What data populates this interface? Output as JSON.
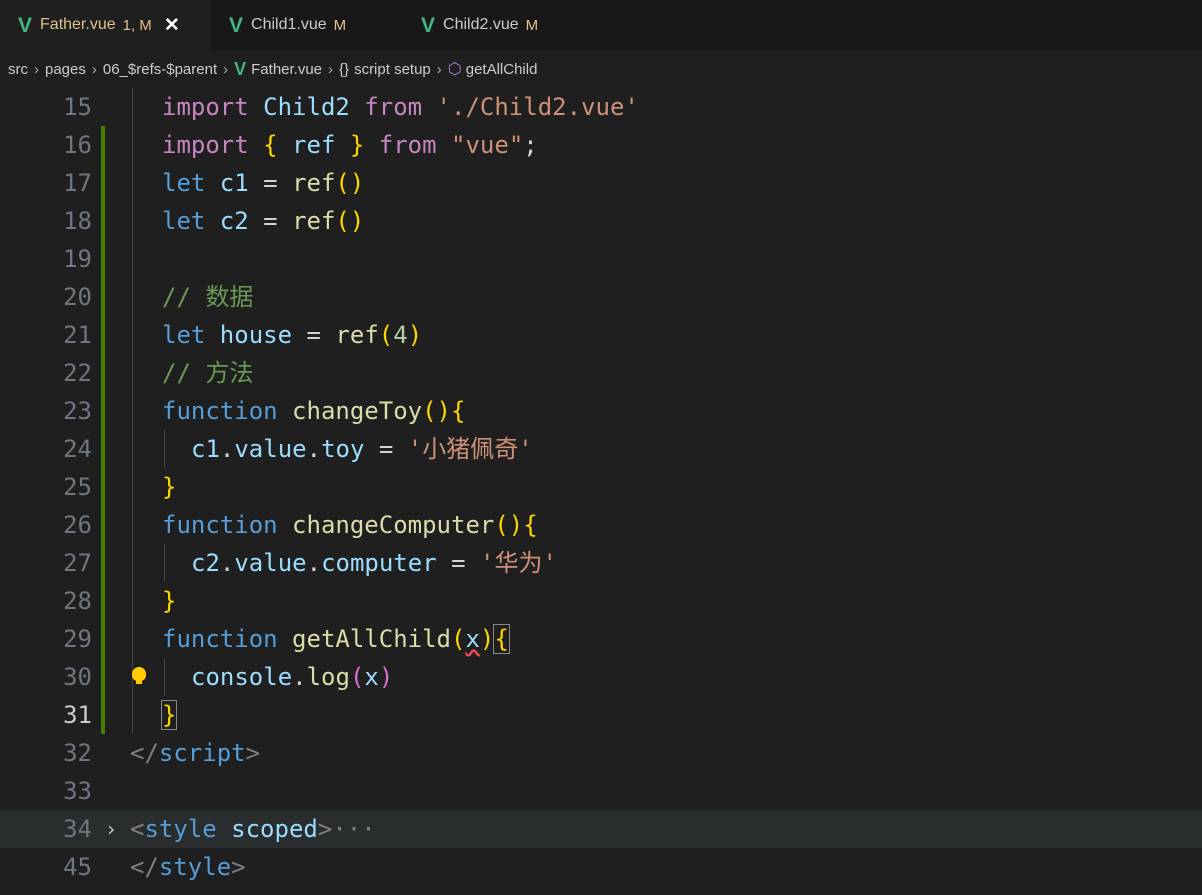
{
  "tabs": [
    {
      "name": "Father.vue",
      "status": "1, M",
      "icon": "vue-icon",
      "active": true
    },
    {
      "name": "Child1.vue",
      "status": "M",
      "icon": "vue-icon",
      "active": false
    },
    {
      "name": "Child2.vue",
      "status": "M",
      "icon": "vue-icon",
      "active": false
    }
  ],
  "breadcrumb": {
    "parts": [
      "src",
      "pages",
      "06_$refs-$parent",
      "Father.vue",
      "script setup",
      "getAllChild"
    ],
    "braces": "{}"
  },
  "lines": [
    {
      "n": "15",
      "tokens": [
        {
          "t": "import",
          "c": "kw2"
        },
        {
          "t": " Child2 ",
          "c": "id"
        },
        {
          "t": "from",
          "c": "kw2"
        },
        {
          "t": " ",
          "c": "op"
        },
        {
          "t": "'./Child2.vue'",
          "c": "str"
        }
      ]
    },
    {
      "n": "16",
      "tokens": [
        {
          "t": "import",
          "c": "kw2"
        },
        {
          "t": " ",
          "c": "op"
        },
        {
          "t": "{",
          "c": "b1"
        },
        {
          "t": " ref ",
          "c": "id"
        },
        {
          "t": "}",
          "c": "b1"
        },
        {
          "t": " ",
          "c": "op"
        },
        {
          "t": "from",
          "c": "kw2"
        },
        {
          "t": " ",
          "c": "op"
        },
        {
          "t": "\"vue\"",
          "c": "str"
        },
        {
          "t": ";",
          "c": "op"
        }
      ]
    },
    {
      "n": "17",
      "tokens": [
        {
          "t": "let",
          "c": "kw"
        },
        {
          "t": " c1 ",
          "c": "id"
        },
        {
          "t": "= ",
          "c": "op"
        },
        {
          "t": "ref",
          "c": "fn"
        },
        {
          "t": "()",
          "c": "b1"
        }
      ]
    },
    {
      "n": "18",
      "tokens": [
        {
          "t": "let",
          "c": "kw"
        },
        {
          "t": " c2 ",
          "c": "id"
        },
        {
          "t": "= ",
          "c": "op"
        },
        {
          "t": "ref",
          "c": "fn"
        },
        {
          "t": "()",
          "c": "b1"
        }
      ]
    },
    {
      "n": "19",
      "tokens": []
    },
    {
      "n": "20",
      "tokens": [
        {
          "t": "// 数据",
          "c": "cm"
        }
      ]
    },
    {
      "n": "21",
      "tokens": [
        {
          "t": "let",
          "c": "kw"
        },
        {
          "t": " house ",
          "c": "id"
        },
        {
          "t": "= ",
          "c": "op"
        },
        {
          "t": "ref",
          "c": "fn"
        },
        {
          "t": "(",
          "c": "b1"
        },
        {
          "t": "4",
          "c": "num"
        },
        {
          "t": ")",
          "c": "b1"
        }
      ]
    },
    {
      "n": "22",
      "tokens": [
        {
          "t": "// 方法",
          "c": "cm"
        }
      ]
    },
    {
      "n": "23",
      "tokens": [
        {
          "t": "function",
          "c": "kw"
        },
        {
          "t": " ",
          "c": "op"
        },
        {
          "t": "changeToy",
          "c": "fn"
        },
        {
          "t": "()",
          "c": "b1"
        },
        {
          "t": "{",
          "c": "b1"
        }
      ]
    },
    {
      "n": "24",
      "indent": 1,
      "tokens": [
        {
          "t": "c1",
          "c": "id"
        },
        {
          "t": ".",
          "c": "op"
        },
        {
          "t": "value",
          "c": "id"
        },
        {
          "t": ".",
          "c": "op"
        },
        {
          "t": "toy",
          "c": "id"
        },
        {
          "t": " = ",
          "c": "op"
        },
        {
          "t": "'小猪佩奇'",
          "c": "str"
        }
      ]
    },
    {
      "n": "25",
      "tokens": [
        {
          "t": "}",
          "c": "b1"
        }
      ]
    },
    {
      "n": "26",
      "tokens": [
        {
          "t": "function",
          "c": "kw"
        },
        {
          "t": " ",
          "c": "op"
        },
        {
          "t": "changeComputer",
          "c": "fn"
        },
        {
          "t": "()",
          "c": "b1"
        },
        {
          "t": "{",
          "c": "b1"
        }
      ]
    },
    {
      "n": "27",
      "indent": 1,
      "tokens": [
        {
          "t": "c2",
          "c": "id"
        },
        {
          "t": ".",
          "c": "op"
        },
        {
          "t": "value",
          "c": "id"
        },
        {
          "t": ".",
          "c": "op"
        },
        {
          "t": "computer",
          "c": "id"
        },
        {
          "t": " = ",
          "c": "op"
        },
        {
          "t": "'华为'",
          "c": "str"
        }
      ]
    },
    {
      "n": "28",
      "tokens": [
        {
          "t": "}",
          "c": "b1"
        }
      ]
    },
    {
      "n": "29",
      "tokens": [
        {
          "t": "function",
          "c": "kw"
        },
        {
          "t": " ",
          "c": "op"
        },
        {
          "t": "getAllChild",
          "c": "fn"
        },
        {
          "t": "(",
          "c": "b1"
        },
        {
          "t": "x",
          "c": "id squiggle"
        },
        {
          "t": ")",
          "c": "b1"
        },
        {
          "t": "{",
          "c": "b1 bracket-match"
        }
      ]
    },
    {
      "n": "30",
      "indent": 1,
      "bulb": true,
      "tokens": [
        {
          "t": "console",
          "c": "id"
        },
        {
          "t": ".",
          "c": "op"
        },
        {
          "t": "log",
          "c": "fn"
        },
        {
          "t": "(",
          "c": "b2"
        },
        {
          "t": "x",
          "c": "id"
        },
        {
          "t": ")",
          "c": "b2"
        }
      ]
    },
    {
      "n": "31",
      "current": true,
      "tokens": [
        {
          "t": "}",
          "c": "b1 bracket-match"
        }
      ]
    },
    {
      "n": "32",
      "outer": true,
      "tokens": [
        {
          "t": "</",
          "c": "punct"
        },
        {
          "t": "script",
          "c": "tag"
        },
        {
          "t": ">",
          "c": "punct"
        }
      ]
    },
    {
      "n": "33",
      "outer": true,
      "tokens": []
    },
    {
      "n": "34",
      "outer": true,
      "fold": true,
      "tokens": [
        {
          "t": "<",
          "c": "punct"
        },
        {
          "t": "style",
          "c": "tag"
        },
        {
          "t": " ",
          "c": "op"
        },
        {
          "t": "scoped",
          "c": "attr"
        },
        {
          "t": ">",
          "c": "punct"
        },
        {
          "t": "···",
          "c": "punct"
        }
      ]
    },
    {
      "n": "45",
      "outer": true,
      "tokens": [
        {
          "t": "</",
          "c": "punct"
        },
        {
          "t": "style",
          "c": "tag"
        },
        {
          "t": ">",
          "c": "punct"
        }
      ]
    }
  ],
  "colors": {
    "background": "#1f1f1f",
    "tabbar": "#181818",
    "vue_green": "#41b883",
    "modified": "#e2c08d",
    "keyword": "#569cd6",
    "string": "#ce9178",
    "function": "#dcdcaa"
  }
}
